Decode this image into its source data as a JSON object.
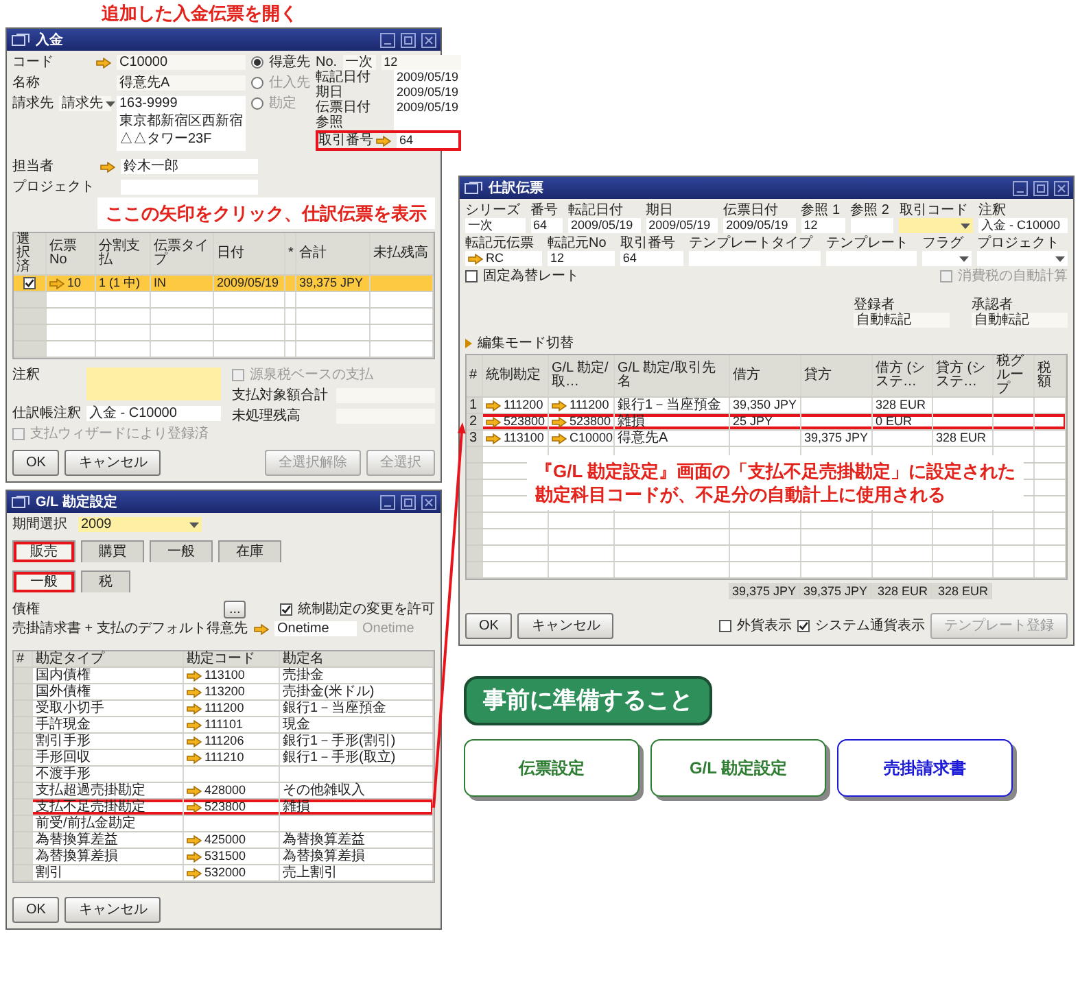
{
  "heading": "追加した入金伝票を開く",
  "windows": [
    {
      "kind": "payment",
      "title": "入金",
      "left_fields": [
        {
          "label": "コード",
          "arrow": true,
          "value": "C10000"
        },
        {
          "label": "名称",
          "value": "得意先A"
        }
      ],
      "bill_to": {
        "label": "請求先",
        "dropdown": "請求先",
        "lines": [
          "163-9999",
          "東京都新宿区西新宿",
          "△△タワー23F"
        ]
      },
      "partner_types": [
        {
          "label": "得意先",
          "selected": true
        },
        {
          "label": "仕入先",
          "selected": false
        },
        {
          "label": "勘定",
          "selected": false
        }
      ],
      "number": {
        "label": "No.",
        "series": "一次",
        "value": "12"
      },
      "right_fields": [
        {
          "label": "転記日付",
          "value": "2009/05/19",
          "highlighted": false
        },
        {
          "label": "期日",
          "value": "2009/05/19",
          "highlighted": false
        },
        {
          "label": "伝票日付",
          "value": "2009/05/19",
          "highlighted": false
        },
        {
          "label": "参照",
          "highlighted": false
        },
        {
          "label": "取引番号",
          "arrow": true,
          "value": "64",
          "highlighted": true
        }
      ],
      "lower_fields": [
        {
          "label": "担当者",
          "arrow": true,
          "value": "鈴木一郎"
        },
        {
          "label": "プロジェクト"
        }
      ],
      "callout": "ここの矢印をクリック、仕訳伝票を表示",
      "table": {
        "columns": [
          {
            "label": "選択済",
            "kind": "checkbox"
          },
          {
            "label": "伝票 No",
            "kind": "text",
            "arrow": true
          },
          {
            "label": "分割支払",
            "kind": "text"
          },
          {
            "label": "伝票タイプ",
            "kind": "text"
          },
          {
            "label": "日付",
            "kind": "text"
          },
          {
            "label": "*",
            "kind": "text"
          },
          {
            "label": "合計",
            "kind": "text"
          },
          {
            "label": "未払残高",
            "kind": "text"
          }
        ],
        "rows": [
          {
            "selected": true,
            "checked": true,
            "cells": [
              null,
              "10",
              "1 (1 中)",
              "IN",
              "2009/05/19",
              null,
              "39,375 JPY",
              null
            ]
          }
        ]
      },
      "withholding": {
        "label": "源泉税ベースの支払",
        "checked": false,
        "disabled": true
      },
      "remarks_label": "注釈",
      "journal_remarks": {
        "label": "仕訳帳注釈",
        "value": "入金 - C10000"
      },
      "totals": [
        {
          "label": "支払対象額合計"
        },
        {
          "label": "未処理残高"
        }
      ],
      "wizard": {
        "label": "支払ウィザードにより登録済",
        "checked": false,
        "disabled": true
      },
      "buttons": [
        {
          "label": "OK",
          "disabled": false
        },
        {
          "label": "キャンセル",
          "disabled": false
        },
        {
          "label": "全選択解除",
          "disabled": true
        },
        {
          "label": "全選択",
          "disabled": true
        }
      ]
    },
    {
      "kind": "journal",
      "title": "仕訳伝票",
      "header_rows": [
        [
          {
            "label": "シリーズ",
            "value": "一次",
            "active": false
          },
          {
            "label": "番号",
            "value": "64",
            "active": false
          },
          {
            "label": "転記日付",
            "value": "2009/05/19",
            "active": false
          },
          {
            "label": "期日",
            "value": "2009/05/19",
            "active": false
          },
          {
            "label": "伝票日付",
            "value": "2009/05/19",
            "active": false
          },
          {
            "label": "参照 1",
            "value": "12",
            "active": false
          },
          {
            "label": "参照 2",
            "active": false
          },
          {
            "label": "取引コード",
            "dropdown": true,
            "active": true
          },
          {
            "label": "注釈",
            "value": "入金 - C10000",
            "active": false
          }
        ],
        [
          {
            "label": "転記元伝票",
            "value": "RC",
            "arrow": true,
            "active": false
          },
          {
            "label": "転記元No",
            "value": "12",
            "active": false
          },
          {
            "label": "取引番号",
            "value": "64",
            "active": false
          },
          {
            "label": "テンプレートタイプ",
            "active": false
          },
          {
            "label": "テンプレート",
            "active": false
          },
          {
            "label": "フラグ",
            "dropdown": true,
            "active": false
          },
          {
            "label": "プロジェクト",
            "dropdown": true,
            "active": false
          }
        ]
      ],
      "fixed_rate": {
        "label": "固定為替レート",
        "checked": false,
        "disabled": false
      },
      "auto_tax": {
        "label": "消費税の自動計算",
        "checked": false,
        "disabled": true
      },
      "approvals": [
        {
          "label": "登録者",
          "value": "自動転記"
        },
        {
          "label": "承認者",
          "value": "自動転記"
        }
      ],
      "edit_mode": "編集モード切替",
      "table": {
        "columns": [
          {
            "label": "#",
            "kind": "rownum"
          },
          {
            "label": "統制勘定",
            "kind": "text",
            "arrow": true
          },
          {
            "label": "G/L 勘定/取…",
            "kind": "text",
            "arrow": true
          },
          {
            "label": "G/L 勘定/取引先名",
            "kind": "text"
          },
          {
            "label": "借方",
            "kind": "text"
          },
          {
            "label": "貸方",
            "kind": "text"
          },
          {
            "label": "借方 (システ…",
            "kind": "text"
          },
          {
            "label": "貸方 (システ…",
            "kind": "text"
          },
          {
            "label": "税グループ",
            "kind": "text"
          },
          {
            "label": "税額",
            "kind": "text"
          }
        ],
        "rows": [
          {
            "highlighted": false,
            "cells": [
              "1",
              "111200",
              "111200",
              "銀行1－当座預金",
              "39,350 JPY",
              null,
              "328 EUR",
              null,
              null,
              null
            ]
          },
          {
            "highlighted": true,
            "cells": [
              "2",
              "523800",
              "523800",
              "雑損",
              "25 JPY",
              null,
              "0 EUR",
              null,
              null,
              null
            ]
          },
          {
            "highlighted": false,
            "cells": [
              "3",
              "113100",
              "C10000",
              "得意先A",
              null,
              "39,375 JPY",
              null,
              "328 EUR",
              null,
              null
            ]
          }
        ]
      },
      "callout": [
        "『G/L 勘定設定』画面の「支払不足売掛勘定」に設定された",
        "勘定科目コードが、不足分の自動計上に使用される"
      ],
      "totals": [
        "39,375 JPY",
        "39,375 JPY",
        "328 EUR",
        "328 EUR"
      ],
      "buttons": [
        {
          "label": "OK",
          "disabled": false
        },
        {
          "label": "キャンセル",
          "disabled": false
        }
      ],
      "footer_checks": [
        {
          "label": "外貨表示",
          "checked": false
        },
        {
          "label": "システム通貨表示",
          "checked": true
        }
      ],
      "template_button": {
        "label": "テンプレート登録",
        "disabled": true
      }
    },
    {
      "kind": "gl",
      "title": "G/L 勘定設定",
      "period": {
        "label": "期間選択",
        "value": "2009"
      },
      "tabs": [
        {
          "label": "販売",
          "selected": true,
          "highlighted": true
        },
        {
          "label": "購買",
          "selected": false,
          "highlighted": false
        },
        {
          "label": "一般",
          "selected": false,
          "highlighted": false
        },
        {
          "label": "在庫",
          "selected": false,
          "highlighted": false
        }
      ],
      "subtabs": [
        {
          "label": "一般",
          "selected": true,
          "highlighted": true
        },
        {
          "label": "税",
          "selected": false,
          "highlighted": false
        }
      ],
      "receivable": {
        "label": "債権",
        "button": "..."
      },
      "allow_change": {
        "label": "統制勘定の変更を許可",
        "checked": true,
        "disabled": false
      },
      "default_customer": {
        "label": "売掛請求書 + 支払のデフォルト得意先",
        "value": "Onetime",
        "name": "Onetime"
      },
      "table": {
        "columns": [
          {
            "label": "#",
            "kind": "rownum"
          },
          {
            "label": "勘定タイプ",
            "kind": "text"
          },
          {
            "label": "勘定コード",
            "kind": "text",
            "arrow": true
          },
          {
            "label": "勘定名",
            "kind": "text"
          }
        ],
        "rows": [
          {
            "highlighted": false,
            "cells": [
              null,
              "国内債権",
              "113100",
              "売掛金"
            ]
          },
          {
            "highlighted": false,
            "cells": [
              null,
              "国外債権",
              "113200",
              "売掛金(米ドル)"
            ]
          },
          {
            "highlighted": false,
            "cells": [
              null,
              "受取小切手",
              "111200",
              "銀行1－当座預金"
            ]
          },
          {
            "highlighted": false,
            "cells": [
              null,
              "手許現金",
              "111101",
              "現金"
            ]
          },
          {
            "highlighted": false,
            "cells": [
              null,
              "割引手形",
              "111206",
              "銀行1－手形(割引)"
            ]
          },
          {
            "highlighted": false,
            "cells": [
              null,
              "手形回収",
              "111210",
              "銀行1－手形(取立)"
            ]
          },
          {
            "highlighted": false,
            "cells": [
              null,
              "不渡手形",
              null,
              null
            ]
          },
          {
            "highlighted": false,
            "cells": [
              null,
              "支払超過売掛勘定",
              "428000",
              "その他雑収入"
            ]
          },
          {
            "highlighted": true,
            "cells": [
              null,
              "支払不足売掛勘定",
              "523800",
              "雑損"
            ]
          },
          {
            "highlighted": false,
            "cells": [
              null,
              "前受/前払金勘定",
              null,
              null
            ]
          },
          {
            "highlighted": false,
            "cells": [
              null,
              "為替換算差益",
              "425000",
              "為替換算差益"
            ]
          },
          {
            "highlighted": false,
            "cells": [
              null,
              "為替換算差損",
              "531500",
              "為替換算差損"
            ]
          },
          {
            "highlighted": false,
            "cells": [
              null,
              "割引",
              "532000",
              "売上割引"
            ]
          }
        ]
      },
      "buttons": [
        {
          "label": "OK",
          "disabled": false
        },
        {
          "label": "キャンセル",
          "disabled": false
        }
      ]
    }
  ],
  "prep": {
    "heading": "事前に準備すること",
    "links": [
      {
        "label": "伝票設定",
        "color": "#2e7d32"
      },
      {
        "label": "G/L 勘定設定",
        "color": "#2e7d32"
      },
      {
        "label": "売掛請求書",
        "color": "#1c1cd6"
      }
    ]
  }
}
